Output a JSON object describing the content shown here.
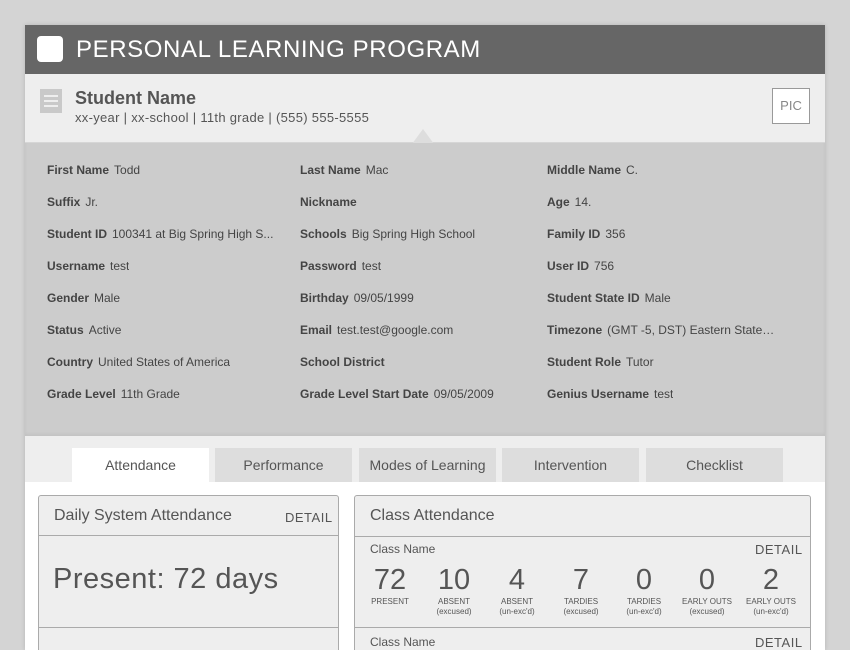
{
  "app": {
    "title": "PERSONAL LEARNING PROGRAM"
  },
  "student": {
    "name": "Student Name",
    "meta": "xx-year | xx-school | 11th grade | (555) 555-5555",
    "pic_label": "PIC"
  },
  "details": [
    {
      "label": "First Name",
      "value": "Todd"
    },
    {
      "label": "Last Name",
      "value": "Mac"
    },
    {
      "label": "Middle Name",
      "value": "C."
    },
    {
      "label": "Suffix",
      "value": "Jr."
    },
    {
      "label": "Nickname",
      "value": ""
    },
    {
      "label": "Age",
      "value": "14."
    },
    {
      "label": "Student ID",
      "value": "100341 at Big Spring High S..."
    },
    {
      "label": "Schools",
      "value": "Big Spring High School"
    },
    {
      "label": "Family ID",
      "value": "356"
    },
    {
      "label": "Username",
      "value": "test"
    },
    {
      "label": "Password",
      "value": "test"
    },
    {
      "label": "User ID",
      "value": "756"
    },
    {
      "label": "Gender",
      "value": "Male"
    },
    {
      "label": "Birthday",
      "value": "09/05/1999"
    },
    {
      "label": "Student State ID",
      "value": "Male"
    },
    {
      "label": "Status",
      "value": "Active"
    },
    {
      "label": "Email",
      "value": "test.test@google.com"
    },
    {
      "label": "Timezone",
      "value": "(GMT -5, DST) Eastern State T..."
    },
    {
      "label": "Country",
      "value": " United States of America"
    },
    {
      "label": "School District",
      "value": ""
    },
    {
      "label": "Student Role",
      "value": " Tutor"
    },
    {
      "label": "Grade Level",
      "value": "11th Grade"
    },
    {
      "label": "Grade Level Start Date",
      "value": "09/05/2009"
    },
    {
      "label": "Genius Username",
      "value": "test"
    }
  ],
  "tabs": [
    {
      "label": "Attendance",
      "active": true
    },
    {
      "label": "Performance",
      "active": false
    },
    {
      "label": "Modes of Learning",
      "active": false
    },
    {
      "label": "Intervention",
      "active": false
    },
    {
      "label": "Checklist",
      "active": false
    }
  ],
  "daily_attendance": {
    "title": "Daily System Attendance",
    "detail_label": "DETAIL",
    "present_text": "Present:  72 days"
  },
  "class_attendance": {
    "title": "Class Attendance",
    "classes": [
      {
        "name": "Class Name",
        "detail_label": "DETAIL",
        "stats": [
          {
            "value": "72",
            "label": "PRESENT",
            "sub": ""
          },
          {
            "value": "10",
            "label": "ABSENT",
            "sub": "(excused)"
          },
          {
            "value": "4",
            "label": "ABSENT",
            "sub": "(un-exc'd)"
          },
          {
            "value": "7",
            "label": "TARDIES",
            "sub": "(excused)"
          },
          {
            "value": "0",
            "label": "TARDIES",
            "sub": "(un-exc'd)"
          },
          {
            "value": "0",
            "label": "EARLY OUTS",
            "sub": "(excused)"
          },
          {
            "value": "2",
            "label": "EARLY OUTS",
            "sub": "(un-exc'd)"
          }
        ]
      },
      {
        "name": "Class Name",
        "detail_label": "DETAIL",
        "stats": []
      }
    ]
  }
}
